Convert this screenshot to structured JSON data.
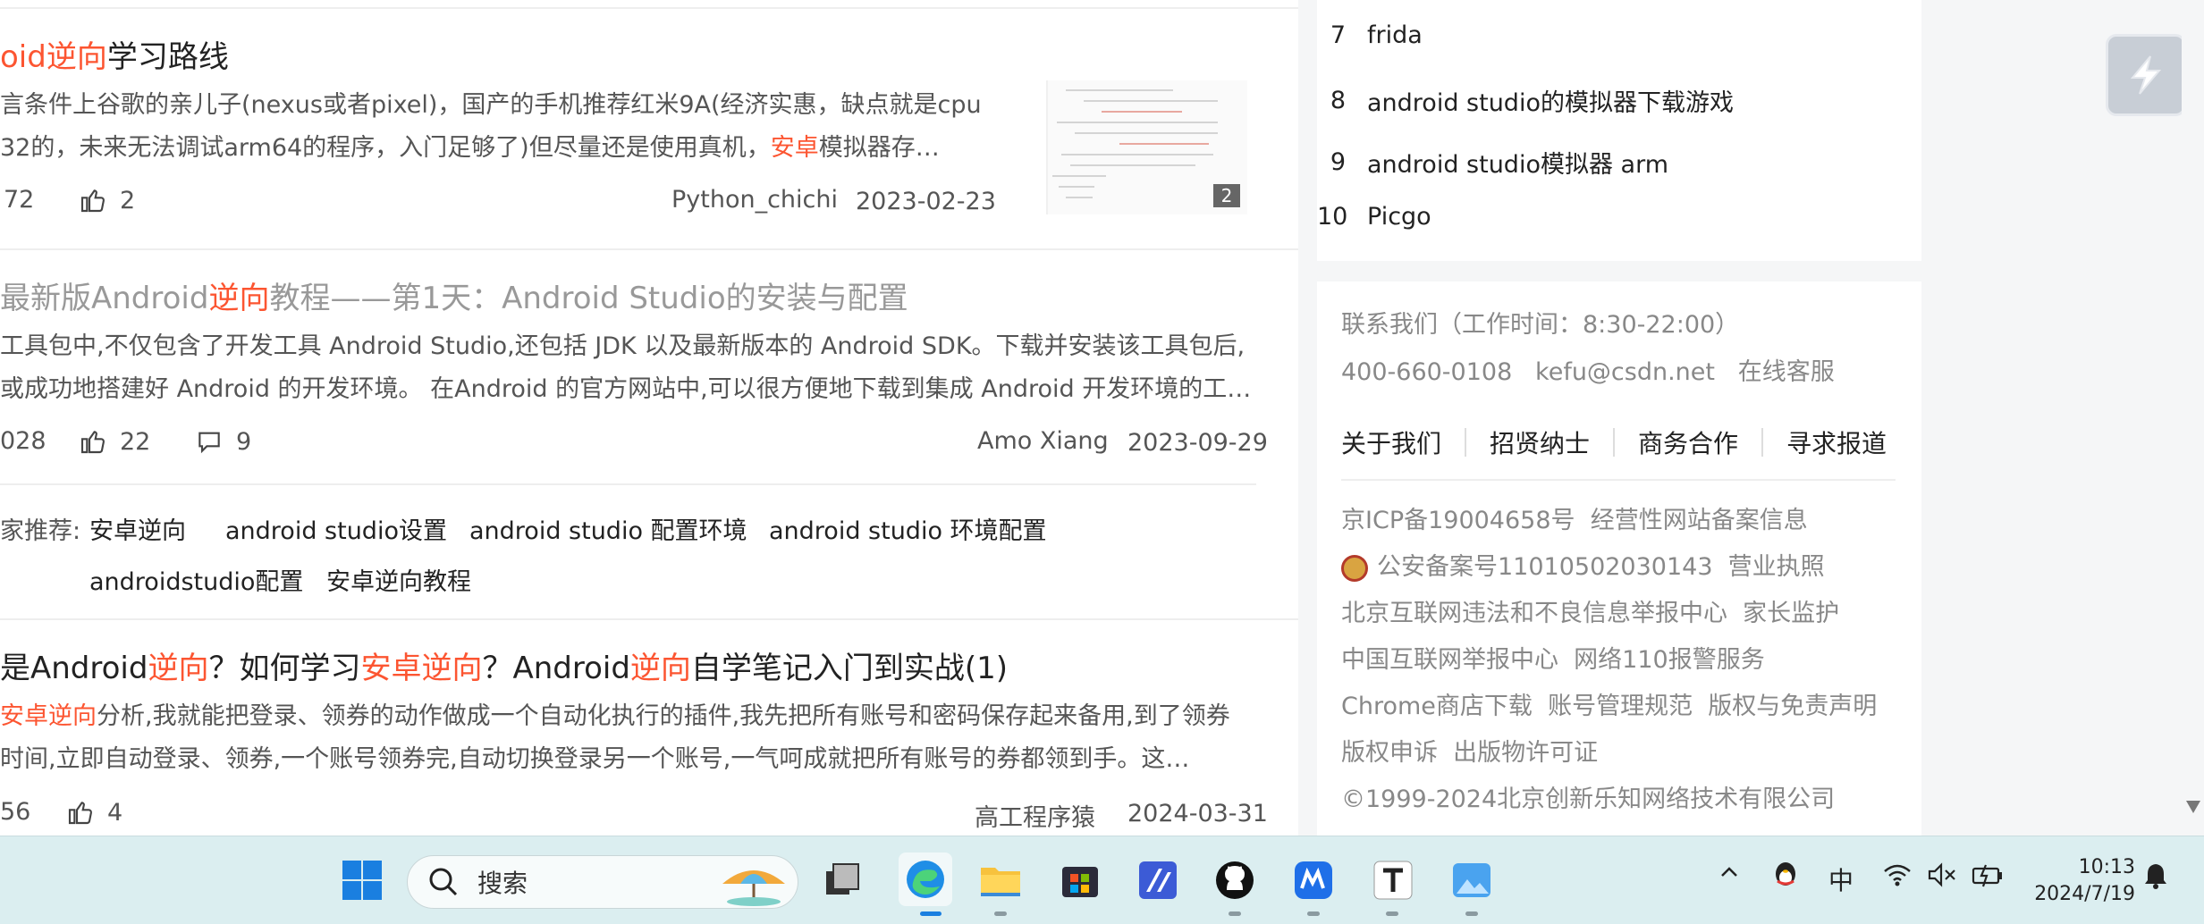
{
  "articles": [
    {
      "title_parts": [
        "oid",
        "逆向",
        "学习路线"
      ],
      "desc_lines": [
        "言条件上谷歌的亲儿子(nexus或者pixel)，国产的手机推荐红米9A(经济实惠，缺点就是cpu",
        "32的，未来无法调试arm64的程序，入门足够了)但尽量还是使用真机，"
      ],
      "desc_hl": "安卓",
      "desc_tail": "模拟器存…",
      "views": "72",
      "likes": "2",
      "author": "Python_chichi",
      "date": "2023-02-23",
      "thumb_count": "2"
    },
    {
      "title_parts": [
        "最新版Android",
        "逆向",
        "教程——第1天：Android Studio的安装与配置"
      ],
      "desc_lines": [
        "工具包中,不仅包含了开发工具 Android Studio,还包括 JDK 以及最新版本的 Android SDK。下载并安装该工具包后,",
        "或成功地搭建好 Android 的开发环境。 在Android 的官方网站中,可以很方便地下载到集成 Android 开发环境的工…"
      ],
      "views": "028",
      "likes": "22",
      "comments": "9",
      "author": "Amo Xiang",
      "date": "2023-09-29"
    },
    {
      "title_parts": [
        "是Android",
        "逆向",
        "？如何学习",
        "安卓逆向",
        "？Android",
        "逆向",
        "自学笔记入门到实战(1)"
      ],
      "desc_hl": "安卓逆向",
      "desc_lines": [
        "分析,我就能把登录、领券的动作做成一个自动化执行的插件,我先把所有账号和密码保存起来备用,到了领券",
        "时间,立即自动登录、领券,一个账号领券完,自动切换登录另一个账号,一气呵成就把所有账号的券都领到手。这…"
      ],
      "views": "56",
      "likes": "4",
      "author": "高工程序猿",
      "date": "2024-03-31"
    }
  ],
  "related": {
    "label": "家推荐:",
    "tags": [
      "安卓逆向",
      "android studio设置",
      "android studio 配置环境",
      "android studio 环境配置",
      "androidstudio配置",
      "安卓逆向教程"
    ]
  },
  "hot_list": [
    {
      "num": "7",
      "text": "frida"
    },
    {
      "num": "8",
      "text": "android studio的模拟器下载游戏"
    },
    {
      "num": "9",
      "text": "android studio模拟器 arm"
    },
    {
      "num": "10",
      "text": "Picgo"
    }
  ],
  "footer": {
    "contact": "联系我们（工作时间：8:30-22:00）",
    "phone": "400-660-0108",
    "email": "kefu@csdn.net",
    "service": "在线客服",
    "links": [
      "关于我们",
      "招贤纳士",
      "商务合作",
      "寻求报道"
    ],
    "icp": "京ICP备19004658号",
    "icp2": "经营性网站备案信息",
    "police": "公安备案号11010502030143",
    "license": "营业执照",
    "report1": "北京互联网违法和不良信息举报中心",
    "parent": "家长监护",
    "report2": "中国互联网举报中心",
    "report3": "网络110报警服务",
    "chrome": "Chrome商店下载",
    "account": "账号管理规范",
    "copyright_stmt": "版权与免责声明",
    "complaint": "版权申诉",
    "publish": "出版物许可证",
    "copyright": "©1999-2024北京创新乐知网络技术有限公司"
  },
  "taskbar": {
    "search_placeholder": "搜索",
    "ime": "中",
    "time": "10:13",
    "date": "2024/7/19"
  },
  "colors": {
    "highlight": "#fc5531",
    "taskbar_bg": "#dbeef0"
  }
}
